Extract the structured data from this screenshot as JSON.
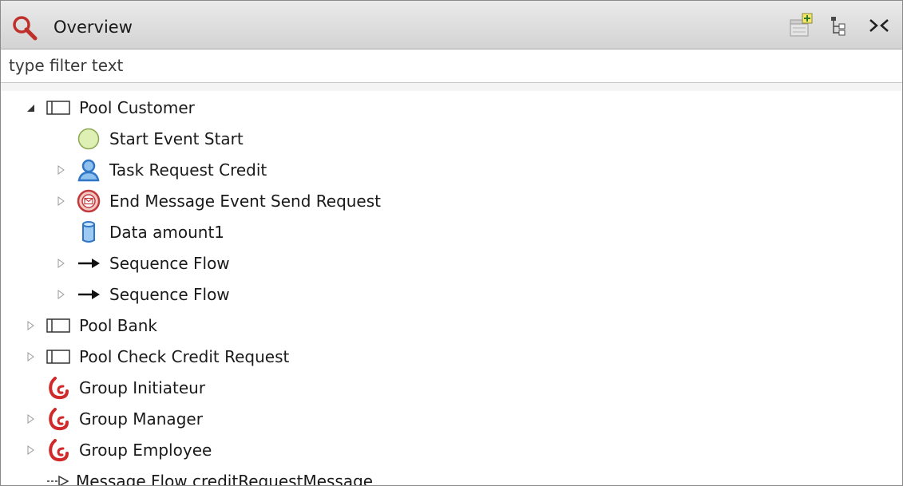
{
  "header": {
    "title": "Overview"
  },
  "filter": {
    "placeholder": "type filter text"
  },
  "tree": {
    "items": [
      {
        "label": "Pool Customer"
      },
      {
        "label": "Start Event Start"
      },
      {
        "label": "Task Request Credit"
      },
      {
        "label": "End Message Event Send Request"
      },
      {
        "label": "Data amount1"
      },
      {
        "label": "Sequence Flow"
      },
      {
        "label": "Sequence Flow"
      },
      {
        "label": "Pool Bank"
      },
      {
        "label": "Pool Check Credit Request"
      },
      {
        "label": "Group Initiateur"
      },
      {
        "label": "Group Manager"
      },
      {
        "label": "Group Employee"
      },
      {
        "label": "Message Flow creditRequestMessage"
      }
    ]
  },
  "icons": {
    "title": "magnifier-icon",
    "toolbar": [
      "new-view-icon",
      "tree-toggle-icon",
      "close-icon"
    ],
    "pool": "pool-icon",
    "start_event": "start-event-circle-icon",
    "task": "user-task-icon",
    "end_message_event": "end-message-event-icon",
    "data": "data-cylinder-icon",
    "sequence_flow": "sequence-arrow-icon",
    "group": "group-swirl-icon",
    "message_flow": "message-flow-dashed-arrow-icon"
  },
  "colors": {
    "group_red": "#d02a2a",
    "task_blue": "#2f76c6",
    "start_green": "#dff0b4",
    "end_red": "#c23a3a"
  }
}
